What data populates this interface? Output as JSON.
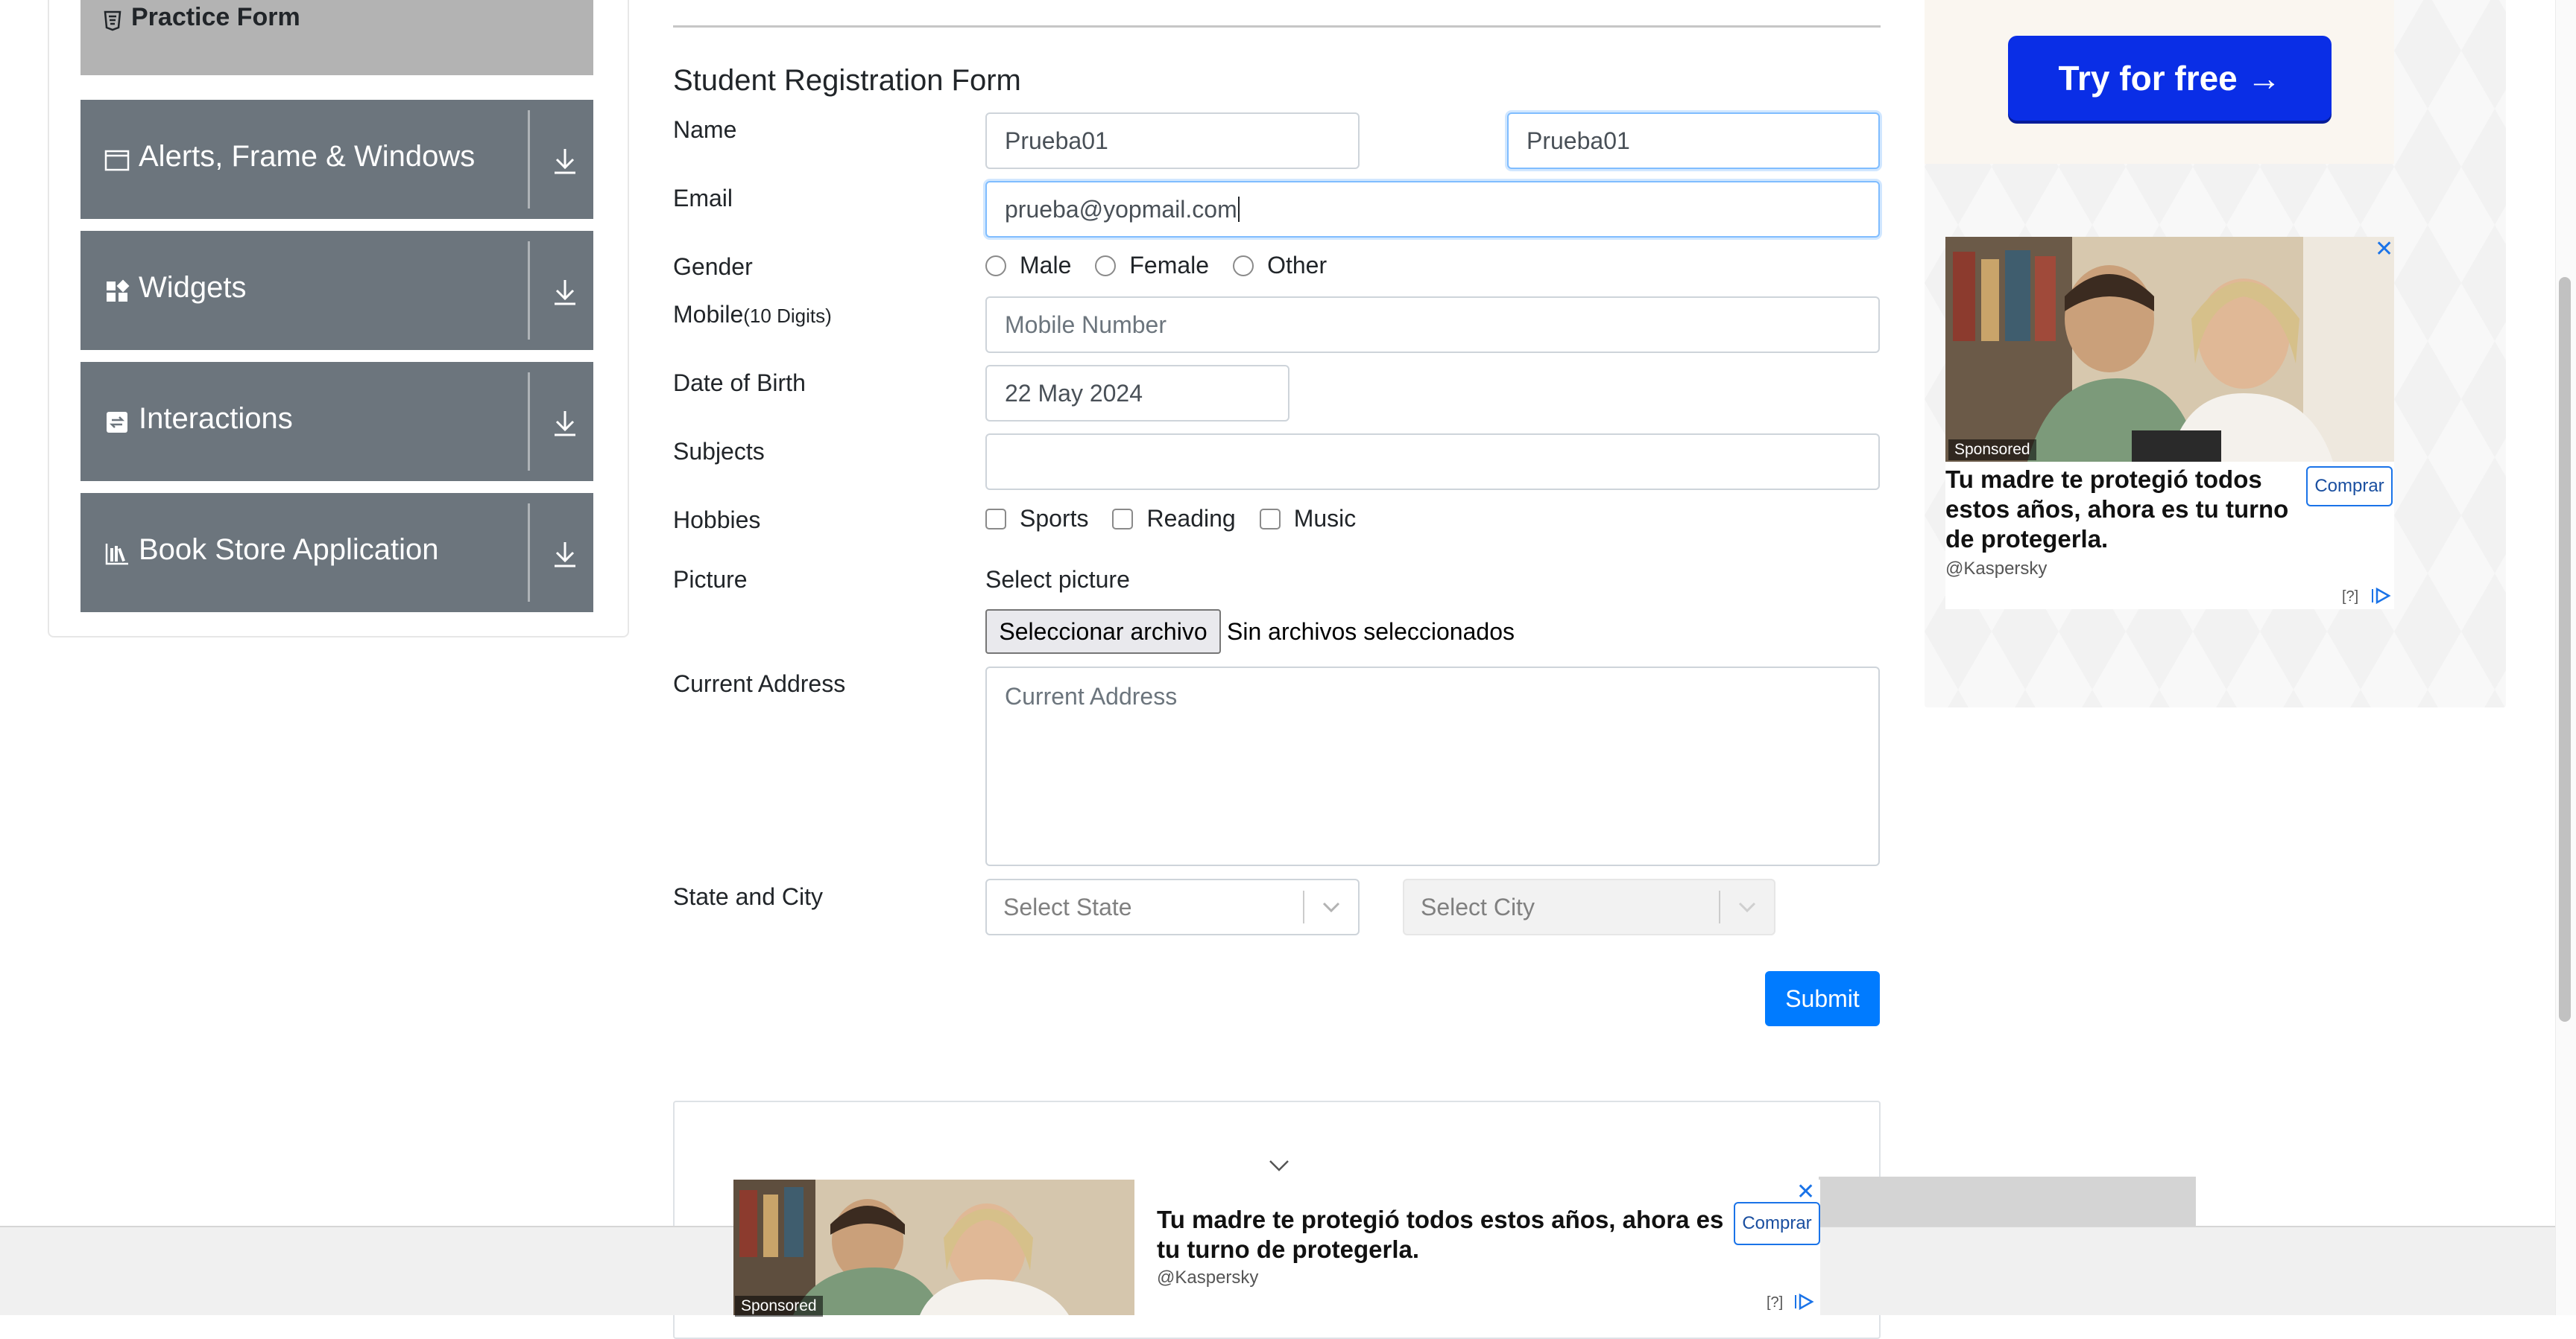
{
  "sidebar": {
    "practice_form": "Practice Form",
    "groups": [
      {
        "label": "Alerts, Frame & Windows",
        "icon": "window-icon"
      },
      {
        "label": "Widgets",
        "icon": "widgets-icon"
      },
      {
        "label": "Interactions",
        "icon": "interactions-icon"
      },
      {
        "label": "Book Store Application",
        "icon": "book-store-icon"
      }
    ]
  },
  "form": {
    "title": "Student Registration Form",
    "name_label": "Name",
    "first_name": "Prueba01",
    "last_name": "Prueba01",
    "email_label": "Email",
    "email_value": "prueba@yopmail.com",
    "gender_label": "Gender",
    "genders": [
      "Male",
      "Female",
      "Other"
    ],
    "mobile_label": "Mobile",
    "mobile_hint": "(10 Digits)",
    "mobile_placeholder": "Mobile Number",
    "dob_label": "Date of Birth",
    "dob_value": "22 May 2024",
    "subjects_label": "Subjects",
    "hobbies_label": "Hobbies",
    "hobbies": [
      "Sports",
      "Reading",
      "Music"
    ],
    "picture_label": "Picture",
    "select_picture": "Select picture",
    "file_button": "Seleccionar archivo",
    "file_status": "Sin archivos seleccionados",
    "address_label": "Current Address",
    "address_placeholder": "Current Address",
    "state_city_label": "State and City",
    "state_placeholder": "Select State",
    "city_placeholder": "Select City",
    "submit": "Submit"
  },
  "ad_right": {
    "cta": "Try for free →",
    "sponsored": "Sponsored",
    "headline": "Tu madre te protegió todos estos años, ahora es tu turno de protegerla.",
    "source": "@Kaspersky",
    "button": "Comprar",
    "close": "✕",
    "info": "[?]"
  },
  "ad_bottom": {
    "sponsored": "Sponsored",
    "headline": "Tu madre te protegió todos estos años, ahora es tu turno de protegerla.",
    "source": "@Kaspersky",
    "button": "Comprar",
    "close": "✕",
    "info": "[?]"
  },
  "colors": {
    "sidebar_group": "#6c757d",
    "sidebar_active": "#b3b3b3",
    "submit": "#007bff",
    "ad_cta": "#0a2ee6"
  }
}
